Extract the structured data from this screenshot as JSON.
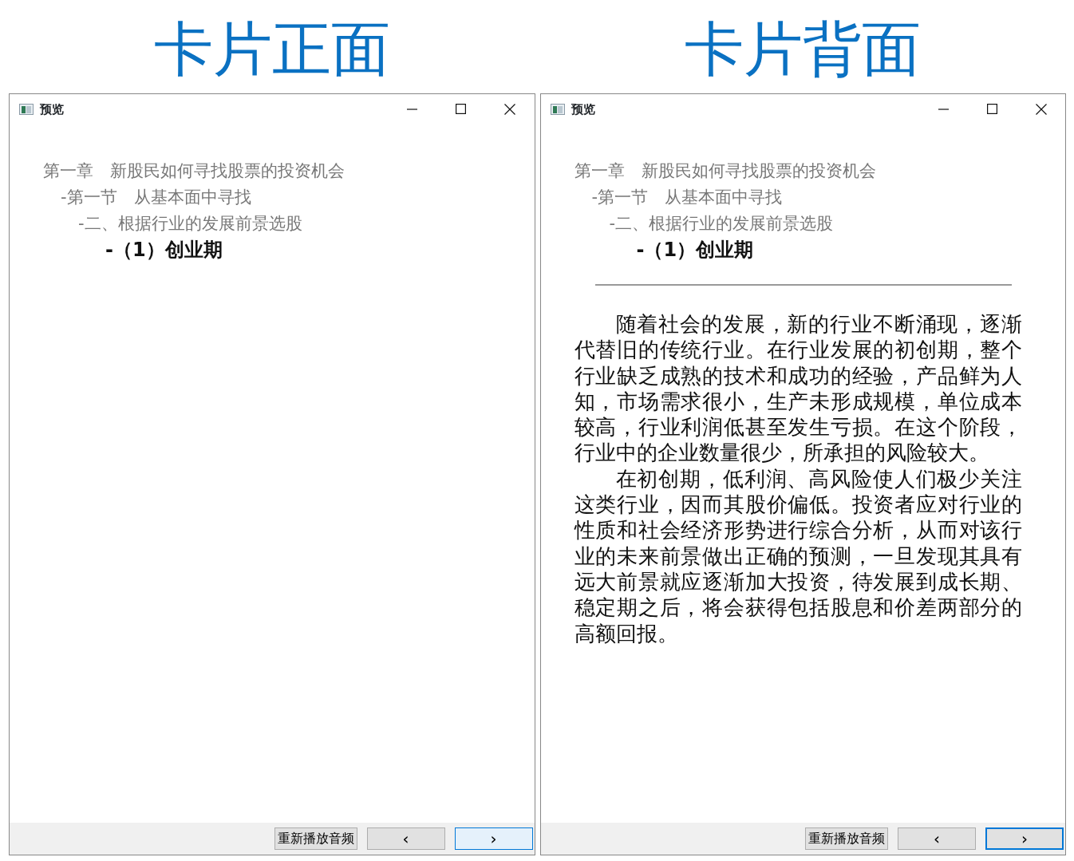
{
  "panels": [
    {
      "heading": "卡片正面",
      "window": {
        "title": "预览"
      },
      "outline": [
        {
          "label": "第一章　新股民如何寻找股票的投资机会",
          "selected": false,
          "children": [
            {
              "label": "-第一节　从基本面中寻找",
              "selected": false,
              "children": [
                {
                  "label": "-二、根据行业的发展前景选股",
                  "selected": false,
                  "children": [
                    {
                      "label": "-（1）创业期",
                      "selected": true
                    }
                  ]
                }
              ]
            }
          ]
        }
      ],
      "buttons": [
        {
          "label": "重新播放音频",
          "hovered": false,
          "focused": false
        },
        {
          "label": "‹",
          "hovered": false,
          "focused": false
        },
        {
          "label": "›",
          "hovered": true,
          "focused": false
        }
      ]
    },
    {
      "heading": "卡片背面",
      "window": {
        "title": "预览"
      },
      "outline": [
        {
          "label": "第一章　新股民如何寻找股票的投资机会",
          "selected": false,
          "children": [
            {
              "label": "-第一节　从基本面中寻找",
              "selected": false,
              "children": [
                {
                  "label": "-二、根据行业的发展前景选股",
                  "selected": false,
                  "children": [
                    {
                      "label": "-（1）创业期",
                      "selected": true
                    }
                  ]
                }
              ]
            }
          ]
        }
      ],
      "paragraphs": [
        "随着社会的发展，新的行业不断涌现，逐渐代替旧的传统行业。在行业发展的初创期，整个行业缺乏成熟的技术和成功的经验，产品鲜为人知，市场需求很小，生产未形成规模，单位成本较高，行业利润低甚至发生亏损。在这个阶段，行业中的企业数量很少，所承担的风险较大。",
        "在初创期，低利润、高风险使人们极少关注这类行业，因而其股价偏低。投资者应对行业的性质和社会经济形势进行综合分析，从而对该行业的未来前景做出正确的预测，一旦发现其具有远大前景就应逐渐加大投资，待发展到成长期、稳定期之后，将会获得包括股息和价差两部分的高额回报。"
      ],
      "buttons": [
        {
          "label": "重新播放音频",
          "hovered": false,
          "focused": false
        },
        {
          "label": "‹",
          "hovered": false,
          "focused": false
        },
        {
          "label": "›",
          "hovered": false,
          "focused": true
        }
      ]
    }
  ]
}
